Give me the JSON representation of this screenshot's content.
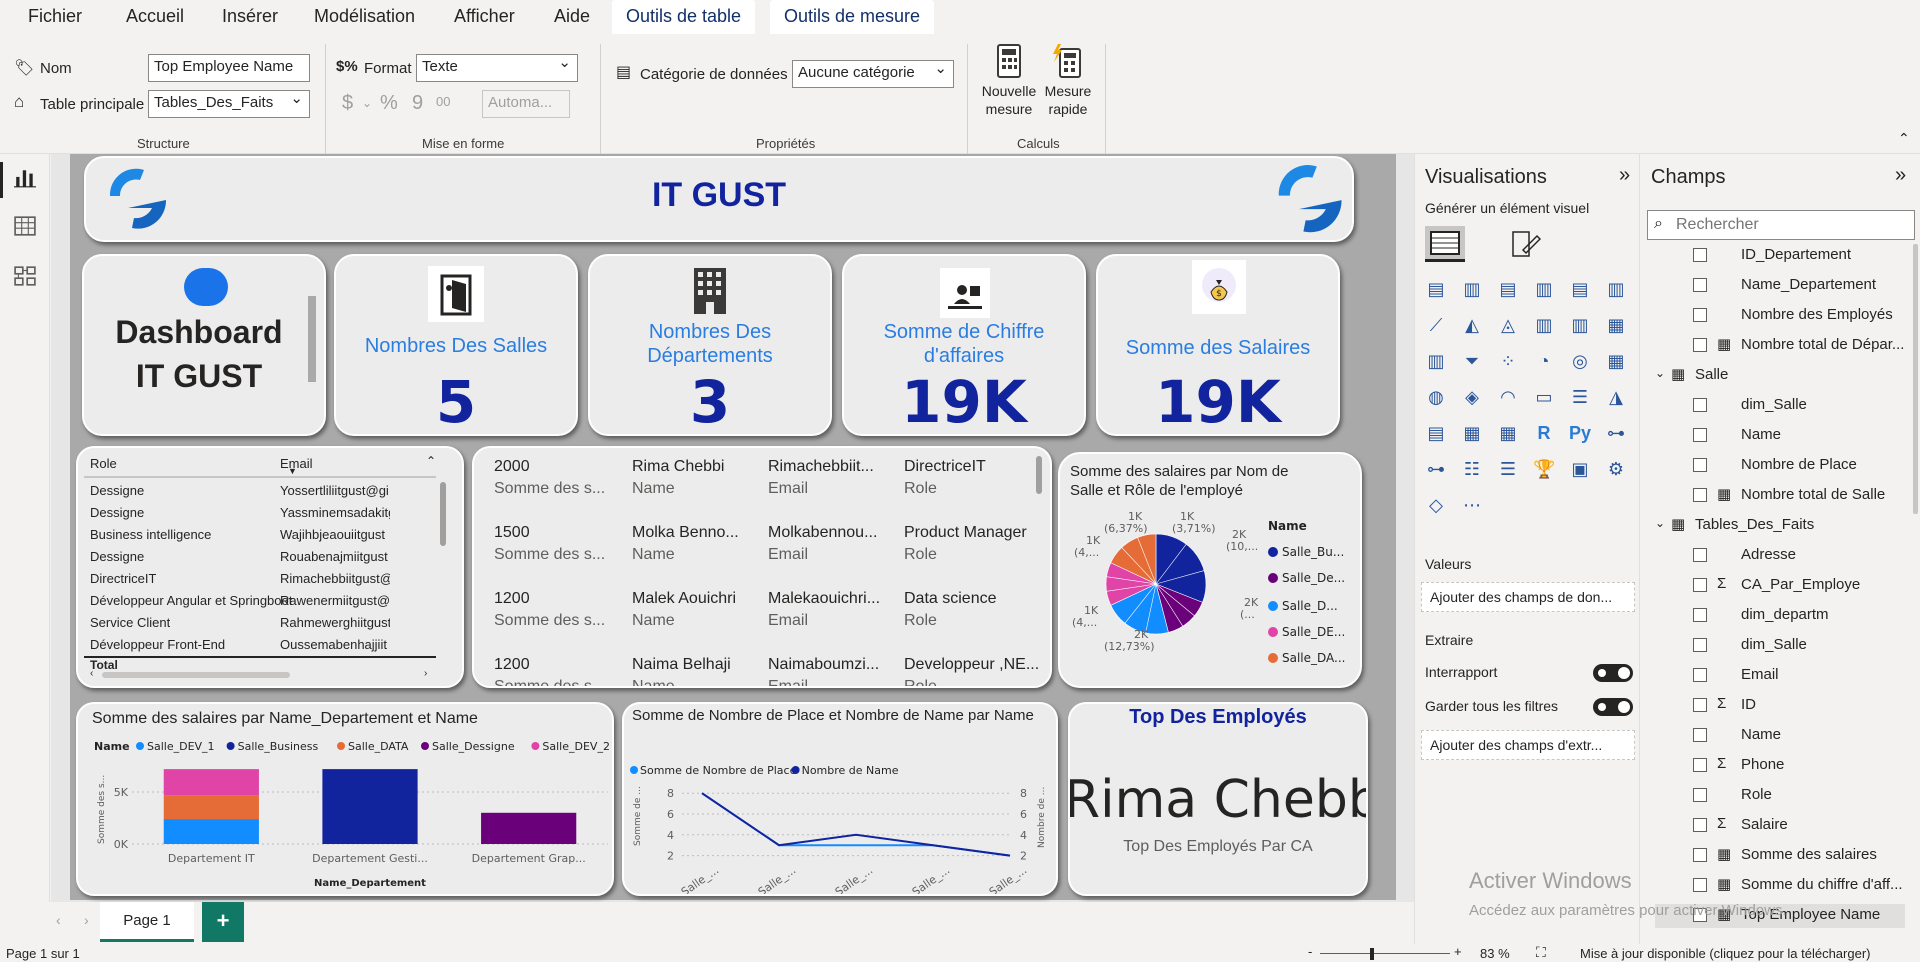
{
  "tabs": [
    "Fichier",
    "Accueil",
    "Insérer",
    "Modélisation",
    "Afficher",
    "Aide",
    "Outils de table",
    "Outils de mesure"
  ],
  "ribbon": {
    "nom_label": "Nom",
    "nom_value": "Top Employee Name",
    "table_label": "Table principale",
    "table_value": "Tables_Des_Faits",
    "format_label": "Format",
    "format_value": "Texte",
    "auto_placeholder": "Automa...",
    "categorie_label": "Catégorie de données",
    "categorie_value": "Aucune catégorie",
    "nouvelle_mesure": [
      "Nouvelle",
      "mesure"
    ],
    "mesure_rapide": [
      "Mesure",
      "rapide"
    ],
    "groups": [
      "Structure",
      "Mise en forme",
      "Propriétés",
      "Calculs"
    ],
    "dollar": "$",
    "percent": "%",
    "comma": "9",
    "decimals": "00"
  },
  "header": {
    "title": "IT GUST"
  },
  "kpis": {
    "dashboard_title": [
      "Dashboard",
      "IT GUST"
    ],
    "cards": [
      {
        "label": "Nombres Des Salles",
        "value": "5"
      },
      {
        "label": "Nombres Des Départements",
        "value": "3"
      },
      {
        "label": "Somme de Chiffre d'affaires",
        "value": "19K"
      },
      {
        "label": "Somme des Salaires",
        "value": "19K"
      }
    ]
  },
  "table_visual": {
    "headers": [
      "Role",
      "Email"
    ],
    "rows": [
      [
        "Dessigne",
        "Yossertliliitgust@gi"
      ],
      [
        "Dessigne",
        "Yassminemsadakitg"
      ],
      [
        "Business intelligence",
        "Wajihbjeaouiitgust"
      ],
      [
        "Dessigne",
        "Rouabenajmiitgust"
      ],
      [
        "DirectriceIT",
        "Rimachebbiitgust@"
      ],
      [
        "Développeur Angular et Springboot",
        "Rawenermiitgust@"
      ],
      [
        "Service Client",
        "Rahmewerghiitgust"
      ],
      [
        "Développeur Front-End",
        "Oussemabenhajjiit"
      ]
    ],
    "total_label": "Total"
  },
  "multirow": {
    "rows": [
      {
        "salary": "2000",
        "name": "Rima Chebbi",
        "email": "Rimachebbiit...",
        "role": "DirectriceIT"
      },
      {
        "salary": "1500",
        "name": "Molka Benno...",
        "email": "Molkabennou...",
        "role": "Product Manager"
      },
      {
        "salary": "1200",
        "name": "Malek Aouichri",
        "email": "Malekaouichri...",
        "role": "Data science"
      },
      {
        "salary": "1200",
        "name": "Naima Belhaji",
        "email": "Naimaboumzi...",
        "role": "Developpeur ,NE..."
      }
    ],
    "sub_labels": [
      "Somme des s...",
      "Name",
      "Email",
      "Role"
    ]
  },
  "pie_chart": {
    "title": [
      "Somme des salaires par Nom de",
      "Salle et Rôle de l'employé"
    ],
    "legend_title": "Name",
    "legend": [
      "Salle_Bu...",
      "Salle_De...",
      "Salle_D...",
      "Salle_DE...",
      "Salle_DA..."
    ],
    "labels": [
      "1K",
      "(6,37%)",
      "1K",
      "(3,71%)",
      "2K",
      "(10,...",
      "1K",
      "(4,...",
      "2K",
      "(...",
      "1K",
      "(4,...",
      "2K",
      "(12,73%)"
    ]
  },
  "chart_data": [
    {
      "type": "pie",
      "title": "Somme des salaires par Nom de Salle et Rôle de l'employé",
      "legend_title": "Name",
      "series": [
        "Salle_Bu...",
        "Salle_De...",
        "Salle_D...",
        "Salle_DE...",
        "Salle_DA..."
      ],
      "legend_colors": [
        "#12239e",
        "#6b007b",
        "#118dff",
        "#e044a7",
        "#e66c37"
      ],
      "slices": [
        {
          "name": "Salle_Bu...",
          "color": "#12239e",
          "percent": 31
        },
        {
          "name": "Salle_De...",
          "color": "#6b007b",
          "percent": 15
        },
        {
          "name": "Salle_D...",
          "color": "#118dff",
          "percent": 22
        },
        {
          "name": "Salle_DE...",
          "color": "#e044a7",
          "percent": 14
        },
        {
          "name": "Salle_DA...",
          "color": "#e66c37",
          "percent": 18
        }
      ]
    },
    {
      "type": "bar",
      "title": "Somme des salaires par Name_Departement et Name",
      "xlabel": "Name_Departement",
      "ylabel": "Somme des s...",
      "categories": [
        "Departement IT",
        "Departement Gesti...",
        "Departement Grap..."
      ],
      "yticks": [
        "5K",
        "0K"
      ],
      "ylim": [
        0,
        7500
      ],
      "legend_title": "Name",
      "series": [
        {
          "name": "Salle_DEV_1",
          "color": "#118dff",
          "values": [
            2400,
            0,
            0
          ]
        },
        {
          "name": "Salle_Business",
          "color": "#12239e",
          "values": [
            0,
            7200,
            0
          ]
        },
        {
          "name": "Salle_DATA",
          "color": "#e66c37",
          "values": [
            2300,
            0,
            0
          ]
        },
        {
          "name": "Salle_Dessigne",
          "color": "#6b007b",
          "values": [
            0,
            0,
            3000
          ]
        },
        {
          "name": "Salle_DEV_2",
          "color": "#e044a7",
          "values": [
            2500,
            0,
            0
          ]
        }
      ]
    },
    {
      "type": "line",
      "title": "Somme de Nombre de Place et Nombre de Name par Name",
      "categories": [
        "Salle_...",
        "Salle_...",
        "Salle_...",
        "Salle_...",
        "Salle_..."
      ],
      "ylabel": "Somme de ...",
      "y2label": "Nombre de ...",
      "yticks": [
        "8",
        "6",
        "4",
        "2"
      ],
      "ylim": [
        1,
        8.5
      ],
      "series": [
        {
          "name": "Somme de Nombre de Place",
          "color": "#118dff",
          "values": [
            8,
            3,
            3,
            3,
            2
          ]
        },
        {
          "name": "Nombre de Name",
          "color": "#12239e",
          "values": [
            8,
            3,
            4,
            3,
            2
          ]
        }
      ]
    }
  ],
  "top_employee": {
    "title": "Top Des Employés",
    "value": "Rima Chebbi",
    "caption": "Top Des Employés Par CA"
  },
  "visualizations": {
    "title": "Visualisations",
    "subtitle": "Générer un élément visuel",
    "valeurs_label": "Valeurs",
    "valeurs_placeholder": "Ajouter des champs de don...",
    "extraire_label": "Extraire",
    "interrapport": "Interrapport",
    "garder_filtres": "Garder tous les filtres",
    "extraire_placeholder": "Ajouter des champs d'extr..."
  },
  "fields": {
    "title": "Champs",
    "search_placeholder": "Rechercher",
    "items": [
      {
        "name": "ID_Departement",
        "icon": "",
        "level": 1
      },
      {
        "name": "Name_Departement",
        "icon": "",
        "level": 1
      },
      {
        "name": "Nombre des Employés",
        "icon": "",
        "level": 1
      },
      {
        "name": "Nombre total de Dépar...",
        "icon": "calc",
        "level": 1
      },
      {
        "name": "Salle",
        "icon": "table",
        "level": 0
      },
      {
        "name": "dim_Salle",
        "icon": "",
        "level": 1
      },
      {
        "name": "Name",
        "icon": "",
        "level": 1
      },
      {
        "name": "Nombre de Place",
        "icon": "",
        "level": 1
      },
      {
        "name": "Nombre total de Salle",
        "icon": "calc",
        "level": 1
      },
      {
        "name": "Tables_Des_Faits",
        "icon": "table",
        "level": 0
      },
      {
        "name": "Adresse",
        "icon": "",
        "level": 1
      },
      {
        "name": "CA_Par_Employe",
        "icon": "sigma",
        "level": 1
      },
      {
        "name": "dim_departm",
        "icon": "",
        "level": 1
      },
      {
        "name": "dim_Salle",
        "icon": "",
        "level": 1
      },
      {
        "name": "Email",
        "icon": "",
        "level": 1
      },
      {
        "name": "ID",
        "icon": "sigma",
        "level": 1
      },
      {
        "name": "Name",
        "icon": "",
        "level": 1
      },
      {
        "name": "Phone",
        "icon": "sigma",
        "level": 1
      },
      {
        "name": "Role",
        "icon": "",
        "level": 1
      },
      {
        "name": "Salaire",
        "icon": "sigma",
        "level": 1
      },
      {
        "name": "Somme des salaires",
        "icon": "calc",
        "level": 1
      },
      {
        "name": "Somme du chiffre d'aff...",
        "icon": "calc",
        "level": 1
      },
      {
        "name": "Top Employee Name",
        "icon": "calc",
        "level": 1
      }
    ]
  },
  "pages": {
    "current": "Page 1",
    "add_label": "+"
  },
  "status": {
    "page_info": "Page 1 sur 1",
    "zoom": "83 %",
    "update": "Mise à jour disponible (cliquez pour la télécharger)",
    "windows_title": "Activer Windows",
    "windows_sub": "Accédez aux paramètres pour activer Windows."
  }
}
